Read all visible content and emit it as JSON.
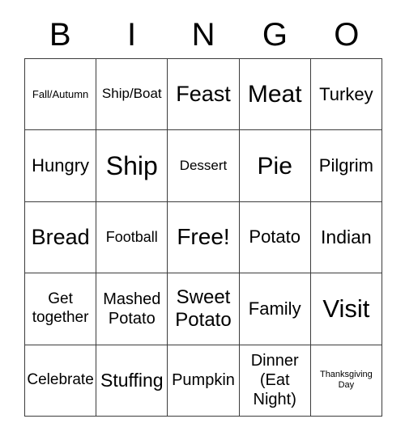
{
  "card": {
    "title_letters": [
      "B",
      "I",
      "N",
      "G",
      "O"
    ],
    "theme": "Thanksgiving",
    "colors": {
      "background": "#ffffff",
      "text": "#000000",
      "grid_border": "#3c3c3c"
    },
    "grid": {
      "columns": 5,
      "rows": 5,
      "free_space_index": 12
    }
  },
  "cells": [
    {
      "text": "Fall/Autumn",
      "size": 13,
      "column": "B",
      "row": 1
    },
    {
      "text": "Ship/Boat",
      "size": 17,
      "column": "I",
      "row": 1
    },
    {
      "text": "Feast",
      "size": 27,
      "column": "N",
      "row": 1
    },
    {
      "text": "Meat",
      "size": 30,
      "column": "G",
      "row": 1
    },
    {
      "text": "Turkey",
      "size": 22,
      "column": "O",
      "row": 1
    },
    {
      "text": "Hungry",
      "size": 22,
      "column": "B",
      "row": 2
    },
    {
      "text": "Ship",
      "size": 32,
      "column": "I",
      "row": 2
    },
    {
      "text": "Dessert",
      "size": 17,
      "column": "N",
      "row": 2
    },
    {
      "text": "Pie",
      "size": 30,
      "column": "G",
      "row": 2
    },
    {
      "text": "Pilgrim",
      "size": 22,
      "column": "O",
      "row": 2
    },
    {
      "text": "Bread",
      "size": 27,
      "column": "B",
      "row": 3
    },
    {
      "text": "Football",
      "size": 18,
      "column": "I",
      "row": 3
    },
    {
      "text": "Free!",
      "size": 28,
      "column": "N",
      "row": 3
    },
    {
      "text": "Potato",
      "size": 22,
      "column": "G",
      "row": 3
    },
    {
      "text": "Indian",
      "size": 23,
      "column": "O",
      "row": 3
    },
    {
      "text": "Get\ntogether",
      "size": 19,
      "column": "B",
      "row": 4
    },
    {
      "text": "Mashed\nPotato",
      "size": 20,
      "column": "I",
      "row": 4
    },
    {
      "text": "Sweet\nPotato",
      "size": 24,
      "column": "N",
      "row": 4
    },
    {
      "text": "Family",
      "size": 22,
      "column": "G",
      "row": 4
    },
    {
      "text": "Visit",
      "size": 31,
      "column": "O",
      "row": 4
    },
    {
      "text": "Celebrate",
      "size": 19,
      "column": "B",
      "row": 5
    },
    {
      "text": "Stuffing",
      "size": 23,
      "column": "I",
      "row": 5
    },
    {
      "text": "Pumpkin",
      "size": 20,
      "column": "N",
      "row": 5
    },
    {
      "text": "Dinner\n(Eat\nNight)",
      "size": 20,
      "column": "G",
      "row": 5
    },
    {
      "text": "Thanksgiving\nDay",
      "size": 11,
      "column": "O",
      "row": 5
    }
  ]
}
